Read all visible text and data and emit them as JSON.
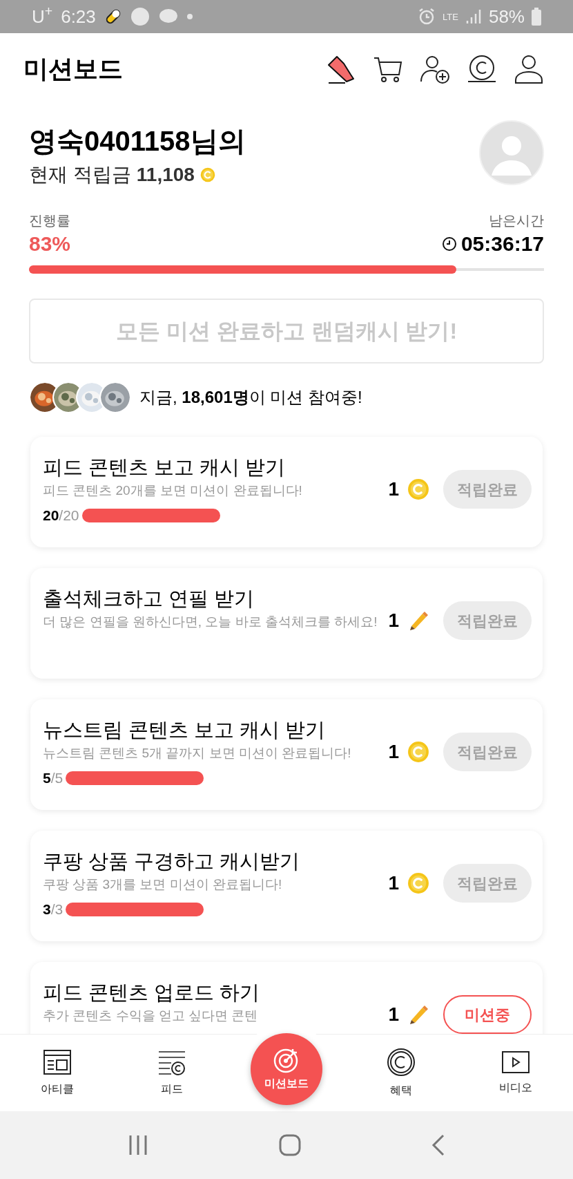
{
  "status_bar": {
    "carrier": "U$^{+}$",
    "time": "6:23",
    "network": "LTE",
    "battery": "58%"
  },
  "header": {
    "title": "미션보드"
  },
  "profile": {
    "name": "영숙0401158님의",
    "balance_label": "현재 적립금",
    "balance": "11,108"
  },
  "progress": {
    "label": "진행률",
    "value": "83%",
    "level": 0.83,
    "time_label": "남은시간",
    "time_left": "05:36:17"
  },
  "bonus_button": {
    "label": "모든 미션 완료하고 랜덤캐시 받기!",
    "disabled": true
  },
  "participants": {
    "text": "지금, **18,601명**이 미션 참여중!"
  },
  "missions": [
    {
      "title": "피드 콘텐츠 보고 캐시 받기",
      "description": "피드 콘텐츠 20개를 보면 미션이 완료됩니다!",
      "kind": "progress",
      "current": "20",
      "total": "/20",
      "reward": {
        "amount": "1",
        "kind": "coin"
      },
      "button": {
        "label": "적립완료",
        "completed": true
      }
    },
    {
      "title": "출석체크하고 연필 받기",
      "description": "더 많은 연필을 원하신다면, 오늘 바로 출석체크를 하세요!",
      "kind": "plain",
      "reward": {
        "amount": "1",
        "kind": "pencil"
      },
      "button": {
        "label": "적립완료",
        "completed": true
      }
    },
    {
      "title": "뉴스트림 콘텐츠 보고 캐시 받기",
      "description": "뉴스트림 콘텐츠 5개 끝까지 보면 미션이 완료됩니다!",
      "kind": "progress",
      "current": "5",
      "total": "/5",
      "reward": {
        "amount": "1",
        "kind": "coin"
      },
      "button": {
        "label": "적립완료",
        "completed": true
      }
    },
    {
      "title": "쿠팡 상품 구경하고 캐시받기",
      "description": "쿠팡 상품 3개를 보면 미션이 완료됩니다!",
      "kind": "progress",
      "current": "3",
      "total": "/3",
      "reward": {
        "amount": "1",
        "kind": "coin"
      },
      "button": {
        "label": "적립완료",
        "completed": true
      }
    },
    {
      "title": "피드 콘텐츠 업로드 하기",
      "description": "추가 콘텐츠 수익을 얻고 싶다면 콘텐",
      "kind": "plain",
      "reward": {
        "amount": "1",
        "kind": "pencil"
      },
      "button": {
        "label": "미션중",
        "completed": false
      }
    }
  ],
  "bottom_nav": [
    {
      "label": "아티클",
      "selected": false
    },
    {
      "label": "피드",
      "selected": false
    },
    {
      "label": "미션보드",
      "selected": true
    },
    {
      "label": "혜택",
      "selected": false
    },
    {
      "label": "비디오",
      "selected": false
    }
  ]
}
